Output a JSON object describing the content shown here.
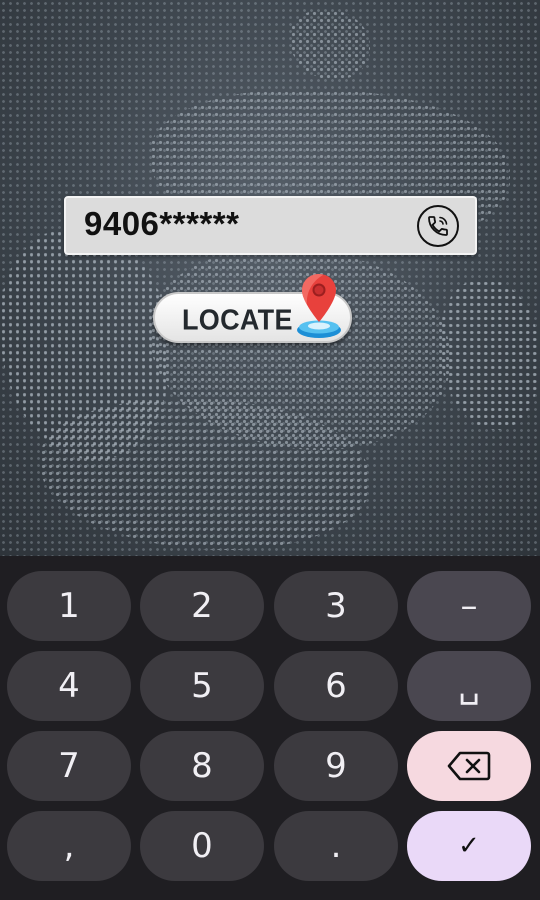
{
  "phone_input": {
    "value": "9406******",
    "call_icon": "phone-call-icon"
  },
  "locate_button": {
    "label": "LOCATE",
    "icon": "map-pin-icon"
  },
  "keyboard": {
    "keys": [
      "1",
      "2",
      "3",
      "–",
      "4",
      "5",
      "6",
      "␣",
      "7",
      "8",
      "9",
      "backspace",
      ",",
      "0",
      ".",
      "✓"
    ],
    "colors": {
      "background": "#1f1e22",
      "key": "#3c3a3f",
      "function_key": "#4a4750",
      "backspace_key": "#f6d9e0",
      "enter_key": "#ead9f8"
    }
  }
}
